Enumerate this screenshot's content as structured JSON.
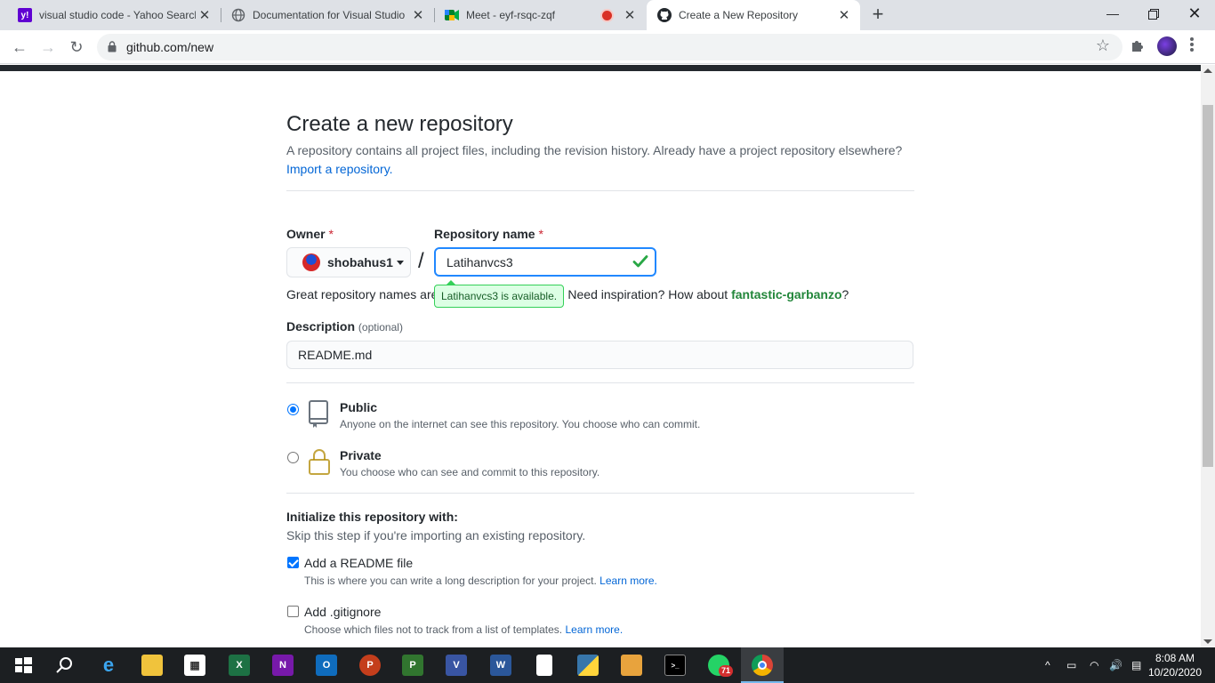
{
  "browser": {
    "tabs": [
      {
        "title": "visual studio code - Yahoo Search",
        "icon": "yahoo-icon"
      },
      {
        "title": "Documentation for Visual Studio",
        "icon": "globe-icon"
      },
      {
        "title": "Meet - eyf-rsqc-zqf",
        "icon": "google-meet-icon"
      },
      {
        "title": "Create a New Repository",
        "icon": "github-icon"
      }
    ],
    "url": "github.com/new"
  },
  "page": {
    "title": "Create a new repository",
    "subtitle": "A repository contains all project files, including the revision history. Already have a project repository elsewhere?",
    "import_link": "Import a repository.",
    "owner_label": "Owner",
    "required_mark": "*",
    "owner_value": "shobahus1",
    "slash": "/",
    "repo_label": "Repository name",
    "repo_value": "Latihanvcs3",
    "availability": "Latihanvcs3 is available.",
    "hint_prefix": "Great repository names are",
    "hint_mid": "Need inspiration? How about",
    "hint_suggestion": "fantastic-garbanzo",
    "hint_suffix": "?",
    "desc_label": "Description",
    "desc_optional": "(optional)",
    "desc_value": "README.md",
    "public_title": "Public",
    "public_note": "Anyone on the internet can see this repository. You choose who can commit.",
    "private_title": "Private",
    "private_note": "You choose who can see and commit to this repository.",
    "init_title": "Initialize this repository with:",
    "init_note": "Skip this step if you're importing an existing repository.",
    "readme_label": "Add a README file",
    "readme_note": "This is where you can write a long description for your project.",
    "gitignore_label": "Add .gitignore",
    "gitignore_note": "Choose which files not to track from a list of templates.",
    "learn_more": "Learn more."
  },
  "taskbar": {
    "time": "8:08 AM",
    "date": "10/20/2020",
    "whatsapp_badge": "71",
    "apps": [
      "start-icon",
      "search-icon",
      "edge-icon",
      "file-explorer-icon",
      "store-icon",
      "excel-icon",
      "onenote-icon",
      "outlook-icon",
      "powerpoint-icon",
      "project-icon",
      "visio-icon",
      "word-icon",
      "notepad-icon",
      "python-icon",
      "game-icon",
      "terminal-icon",
      "whatsapp-icon",
      "chrome-icon"
    ]
  },
  "colors": {
    "accent": "#0366d6",
    "success": "#22863a",
    "danger": "#cb2431",
    "focus": "#2188ff"
  }
}
